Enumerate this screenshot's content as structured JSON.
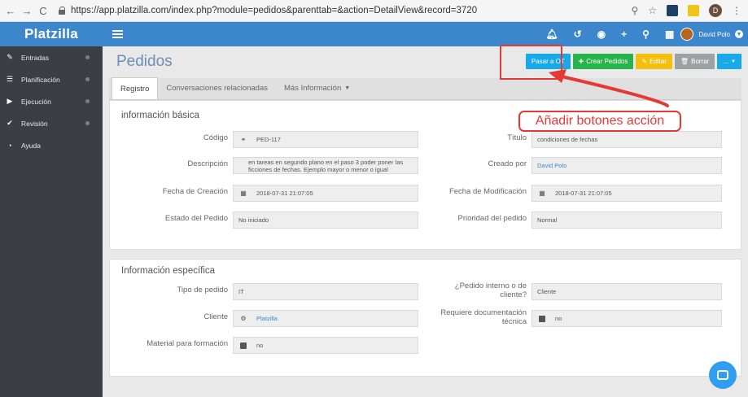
{
  "browser": {
    "url": "https://app.platzilla.com/index.php?module=pedidos&parenttab=&action=DetailView&record=3720",
    "profile_initial": "D"
  },
  "app": {
    "logo": "Platzilla"
  },
  "sidebar": {
    "items": [
      {
        "label": "Entradas",
        "icon": "edit-icon"
      },
      {
        "label": "Planificación",
        "icon": "list-icon"
      },
      {
        "label": "Ejecución",
        "icon": "play-icon"
      },
      {
        "label": "Revisión",
        "icon": "check-icon"
      },
      {
        "label": "Ayuda",
        "icon": "chat-icon"
      }
    ]
  },
  "topbar": {
    "icons": [
      "bell-icon",
      "history-icon",
      "eye-icon",
      "plus-icon",
      "search-icon",
      "grid-icon"
    ],
    "user_name": "David Polo"
  },
  "page": {
    "title": "Pedidos",
    "actions": {
      "pasar_ot": "Pasar a OT",
      "crear": "Crear Pedidos",
      "editar": "Editar",
      "borrar": "Borrar",
      "more": "..."
    },
    "tabs": [
      "Registro",
      "Conversaciones relacionadas",
      "Más Información"
    ]
  },
  "basic": {
    "title": "información básica",
    "codigo_label": "Código",
    "codigo_value": "PED-117",
    "descripcion_label": "Descripción",
    "descripcion_value": "en tareas en segundo plano en el paso 3 poder poner las ficciones de fechas. Ejemplo mayor o menor o igual",
    "fecha_creacion_label": "Fecha de Creación",
    "fecha_creacion_value": "2018-07-31 21:07:05",
    "estado_label": "Estado del Pedido",
    "estado_value": "No iniciado",
    "titulo_label": "Título",
    "titulo_value": "condiciones de fechas",
    "creado_label": "Creado por",
    "creado_value": "David Polo",
    "fecha_mod_label": "Fecha de Modificación",
    "fecha_mod_value": "2018-07-31 21:07:05",
    "prioridad_label": "Prioridad del pedido",
    "prioridad_value": "Normal"
  },
  "specific": {
    "title": "Información específica",
    "tipo_label": "Tipo de pedido",
    "tipo_value": "IT",
    "cliente_label": "Cliente",
    "cliente_value": "Platzilla",
    "material_label": "Material para formación",
    "material_value": "no",
    "interno_label_1": "¿Pedido interno o de",
    "interno_label_2": "cliente?",
    "interno_value": "Cliente",
    "doc_label_1": "Requiere documentación",
    "doc_label_2": "técnica",
    "doc_value": "no"
  },
  "annotation": {
    "text": "Añadir botones acción",
    "color": "#e53935"
  }
}
